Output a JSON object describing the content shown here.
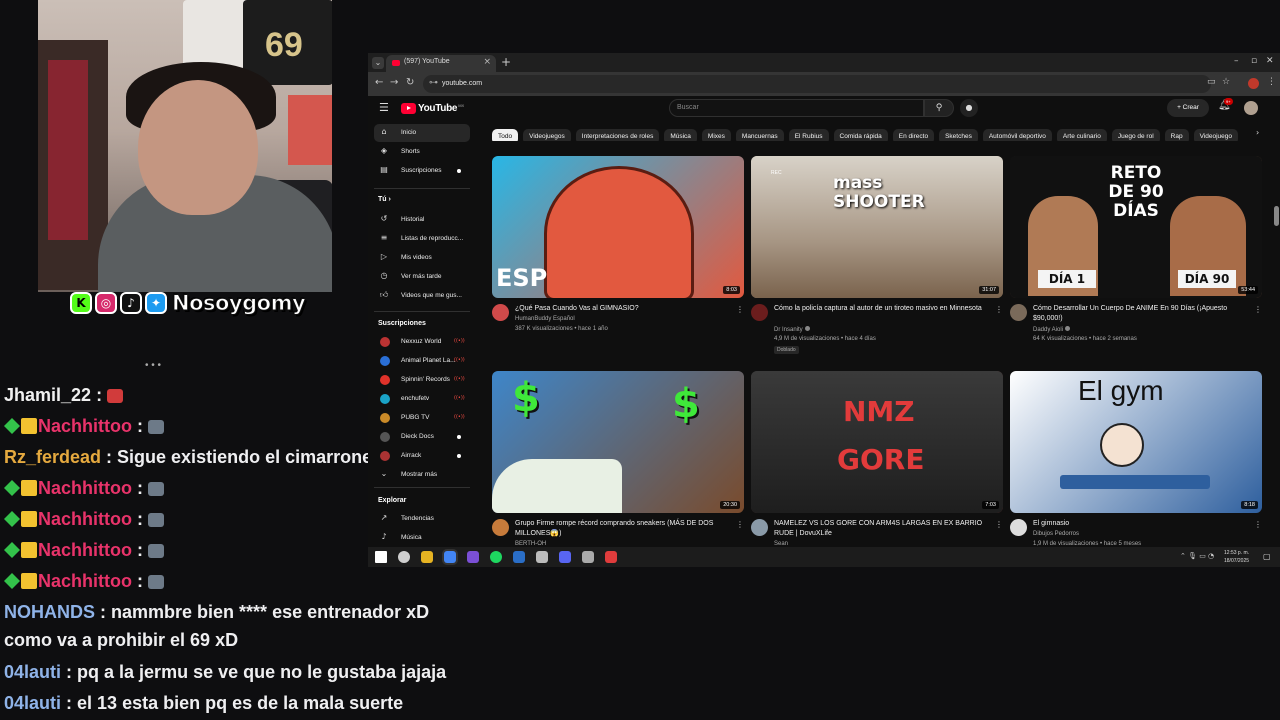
{
  "stream": {
    "handle": "Nosoygomy",
    "social_icons": [
      "kick-icon",
      "instagram-icon",
      "tiktok-icon",
      "twitter-icon"
    ]
  },
  "chat": {
    "messages": [
      {
        "user": "Jhamil_22",
        "color": "#f0f0f0",
        "badges": [],
        "text": "",
        "emote": "red"
      },
      {
        "user": "Nachhittoo",
        "color": "#e8336a",
        "badges": [
          "diamond",
          "crown"
        ],
        "text": "",
        "emote": "gray"
      },
      {
        "user": "Rz_ferdead",
        "color": "#e5a93f",
        "badges": [],
        "text": "Sigue existiendo el cimarrones",
        "emote": ""
      },
      {
        "user": "Nachhittoo",
        "color": "#e8336a",
        "badges": [
          "diamond",
          "crown"
        ],
        "text": "",
        "emote": "gray"
      },
      {
        "user": "Nachhittoo",
        "color": "#e8336a",
        "badges": [
          "diamond",
          "crown"
        ],
        "text": "",
        "emote": "gray"
      },
      {
        "user": "Nachhittoo",
        "color": "#e8336a",
        "badges": [
          "diamond",
          "crown"
        ],
        "text": "",
        "emote": "gray"
      },
      {
        "user": "Nachhittoo",
        "color": "#e8336a",
        "badges": [
          "diamond",
          "crown"
        ],
        "text": "",
        "emote": "gray"
      },
      {
        "user": "NOHANDS",
        "color": "#8fb3e8",
        "badges": [],
        "text": "nammbre bien **** ese entrenador xD",
        "emote": ""
      },
      {
        "user": "",
        "color": "#f0f0f0",
        "badges": [],
        "text": "como va a prohibir el 69 xD",
        "emote": ""
      },
      {
        "user": "04lauti",
        "color": "#8fb3e8",
        "badges": [],
        "text": "pq a la jermu se ve que no le gustaba jajaja",
        "emote": ""
      },
      {
        "user": "04lauti",
        "color": "#8fb3e8",
        "badges": [],
        "text": "el 13 esta bien pq es de la mala suerte",
        "emote": ""
      }
    ]
  },
  "browser": {
    "tab_title": "(597) YouTube",
    "url": "youtube.com"
  },
  "youtube": {
    "logo_text": "YouTube",
    "logo_country": "MX",
    "search_placeholder": "Buscar",
    "create_label": "+ Crear",
    "notif_count": "9+",
    "sidebar": {
      "main": [
        {
          "label": "Inicio",
          "icon": "home-icon",
          "active": true
        },
        {
          "label": "Shorts",
          "icon": "shorts-icon"
        },
        {
          "label": "Suscripciones",
          "icon": "subscriptions-icon",
          "dot": true
        }
      ],
      "you_label": "Tú",
      "you": [
        {
          "label": "Historial",
          "icon": "history-icon"
        },
        {
          "label": "Listas de reproducc...",
          "icon": "playlists-icon"
        },
        {
          "label": "Mis videos",
          "icon": "my-videos-icon"
        },
        {
          "label": "Ver más tarde",
          "icon": "watch-later-icon"
        },
        {
          "label": "Videos que me gus...",
          "icon": "like-icon"
        }
      ],
      "subs_label": "Suscripciones",
      "subs": [
        {
          "label": "Nexxuz World",
          "color": "#b33",
          "status": "live"
        },
        {
          "label": "Animal Planet La...",
          "color": "#2a6fd6",
          "status": "live"
        },
        {
          "label": "Spinnin' Records",
          "color": "#e0322a",
          "status": "live"
        },
        {
          "label": "enchufetv",
          "color": "#1aa3c7",
          "status": "live"
        },
        {
          "label": "PUBG TV",
          "color": "#c98a28",
          "status": "live"
        },
        {
          "label": "Dieck Docs",
          "color": "#555",
          "status": "dot"
        },
        {
          "label": "Airrack",
          "color": "#a33",
          "status": "dot"
        }
      ],
      "show_more": "Mostrar más",
      "explore_label": "Explorar",
      "explore": [
        {
          "label": "Tendencias",
          "icon": "trending-icon"
        },
        {
          "label": "Música",
          "icon": "music-icon"
        }
      ]
    },
    "chips": [
      "Todo",
      "Videojuegos",
      "Interpretaciones de roles",
      "Música",
      "Mixes",
      "Mancuernas",
      "El Rubius",
      "Comida rápida",
      "En directo",
      "Sketches",
      "Automóvil deportivo",
      "Arte culinario",
      "Juego de rol",
      "Rap",
      "Videojuego"
    ],
    "videos": [
      {
        "title": "¿Qué Pasa Cuando Vas al GIMNASIO?",
        "channel": "HumanBuddy Español",
        "verified": false,
        "meta": "387 K visualizaciones • hace 1 año",
        "duration": "8:03",
        "thumb_text": "ESP",
        "badge": "",
        "avatar_color": "#d04a4a",
        "thumb_colors": [
          "#28b7e6",
          "#e2593f"
        ]
      },
      {
        "title": "Cómo la policía captura al autor de un tiroteo masivo en Minnesota",
        "channel": "Dr Insanity",
        "verified": true,
        "meta": "4,9 M de visualizaciones • hace 4 días",
        "duration": "31:07",
        "thumb_text": "mass SHOOTER",
        "thumb_sub": "REC",
        "badge": "Doblado",
        "avatar_color": "#6b1d1d",
        "thumb_colors": [
          "#b9ad9e",
          "#6e5b47"
        ]
      },
      {
        "title": "Cómo Desarrollar Un Cuerpo De ANIME En 90 Días (¡Apuesto $90,000!)",
        "channel": "Daddy Aioli",
        "verified": true,
        "meta": "64 K visualizaciones • hace 2 semanas",
        "duration": "53:44",
        "thumb_text": "RETO DE 90 DÍAS",
        "thumb_labels": [
          "DÍA 1",
          "DÍA 90"
        ],
        "badge": "",
        "avatar_color": "#7a6a5a",
        "thumb_colors": [
          "#1b1b1b",
          "#8a5a40"
        ]
      },
      {
        "title": "Grupo Firme rompe récord comprando sneakers (MÁS DE DOS MILLONES😱)",
        "channel": "BERTH-OH",
        "verified": false,
        "meta": "",
        "duration": "20:30",
        "thumb_text": "$",
        "badge": "",
        "avatar_color": "#c77b3b",
        "thumb_colors": [
          "#3e86c9",
          "#7a4b2c"
        ]
      },
      {
        "title": "NAMELEZ VS LOS GORE CON ARM4S LARGAS EN EX BARRIO RUDE | DovuXLife",
        "channel": "Sean",
        "verified": false,
        "meta": "",
        "duration": "7:03",
        "thumb_text": "NMZ",
        "thumb_sub": "GORE",
        "badge": "",
        "avatar_color": "#8a9aa8",
        "thumb_colors": [
          "#2b2b2b",
          "#6e2424"
        ]
      },
      {
        "title": "El gimnasio",
        "channel": "Dibujos Pedorros",
        "verified": false,
        "meta": "1,9 M de visualizaciones • hace 5 meses",
        "duration": "8:18",
        "thumb_text": "El gym",
        "badge": "",
        "avatar_color": "#dddddd",
        "thumb_colors": [
          "#ffffff",
          "#2e5f9e"
        ]
      }
    ]
  },
  "taskbar": {
    "clock_time": "12:53 p. m.",
    "clock_date": "18/07/2025",
    "apps": [
      "windows-start-icon",
      "search-icon",
      "file-explorer-icon",
      "chrome-icon",
      "obs-icon",
      "spotify-icon",
      "steam-icon",
      "app-icon",
      "discord-icon",
      "settings-icon",
      "recorder-icon"
    ]
  }
}
